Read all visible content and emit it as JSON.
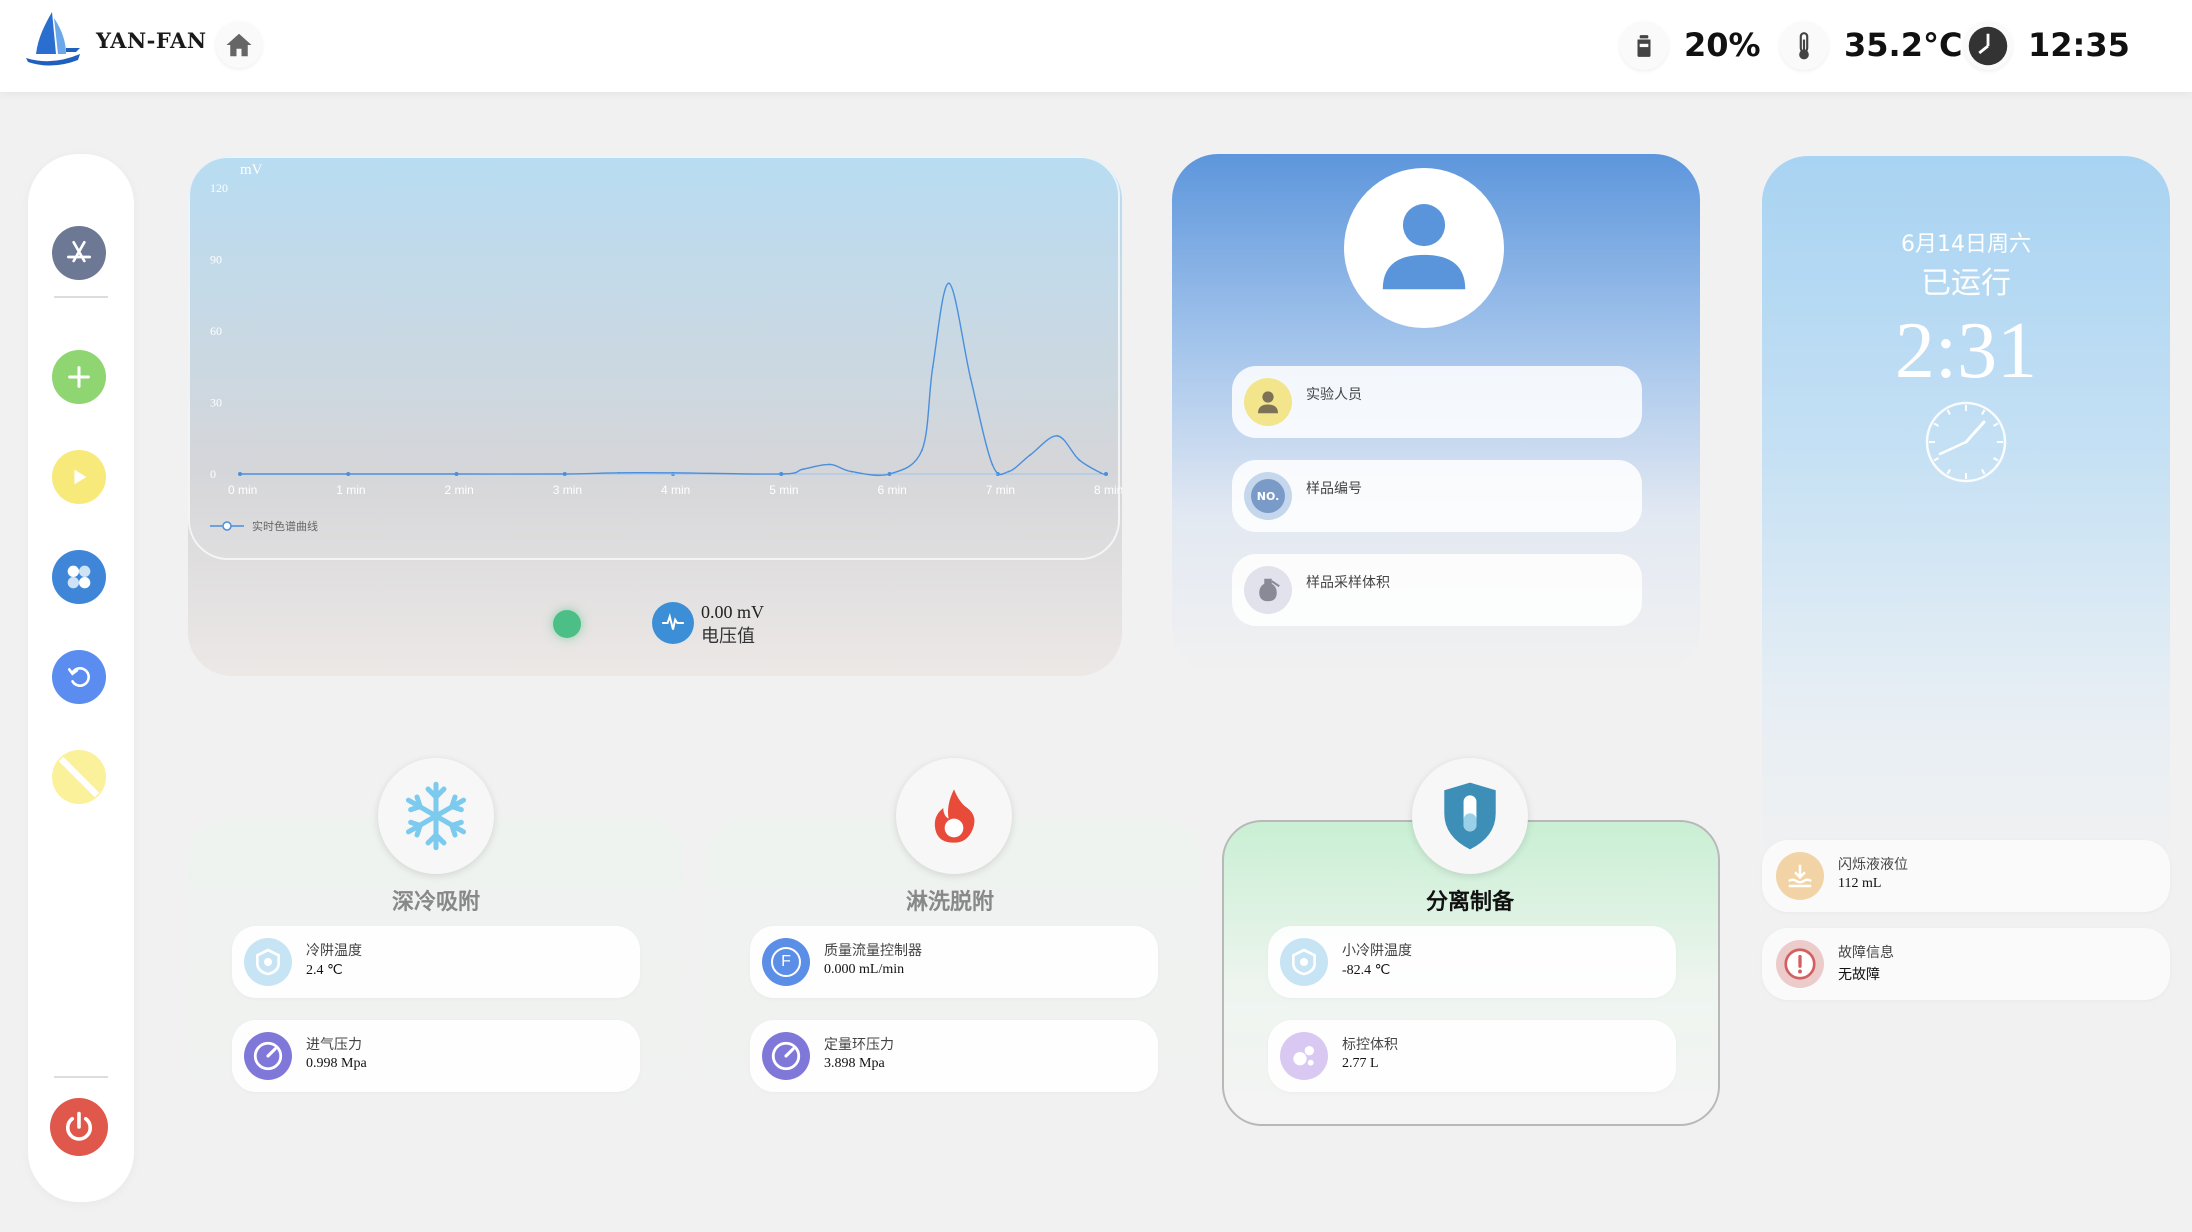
{
  "header": {
    "brand": "YAN-FAN",
    "level": "20%",
    "temperature": "35.2°C",
    "time": "12:35"
  },
  "chart_data": {
    "type": "line",
    "ylabel": "mV",
    "ylim": [
      0,
      120
    ],
    "y_ticks": [
      "120",
      "90",
      "60",
      "30",
      "0"
    ],
    "x_ticks": [
      "0 min",
      "1 min",
      "2 min",
      "3 min",
      "4 min",
      "5 min",
      "6 min",
      "7 min",
      "8 min"
    ],
    "xlim": [
      0,
      8
    ],
    "legend": "top-left-below",
    "series": [
      {
        "name": "实时色谱曲线",
        "x": [
          0,
          1,
          2,
          3,
          3.5,
          4,
          5,
          5.2,
          5.45,
          5.65,
          6.0,
          6.3,
          6.4,
          6.55,
          6.75,
          6.95,
          7.1,
          7.3,
          7.55,
          7.75,
          7.95,
          8.0
        ],
        "y": [
          0,
          0,
          0,
          0,
          0.5,
          0.5,
          0,
          2,
          4,
          1,
          0,
          10,
          45,
          80,
          40,
          4,
          1,
          8,
          16,
          6,
          0.5,
          0
        ]
      }
    ]
  },
  "chart_panel": {
    "voltage_value": "0.00 mV",
    "voltage_label": "电压值"
  },
  "profile": {
    "rows": [
      "实验人员",
      "样品编号",
      "样品采样体积"
    ],
    "no_badge": "NO."
  },
  "clock": {
    "date": "6月14日周六",
    "run_label": "已运行",
    "run_time": "2:31"
  },
  "status_rows": [
    {
      "title": "闪烁液液位",
      "value": "112 mL"
    },
    {
      "title": "故障信息",
      "value": "无故障"
    }
  ],
  "modules": [
    {
      "title": "深冷吸附",
      "params": [
        {
          "title": "冷阱温度",
          "value": "2.4 ℃"
        },
        {
          "title": "进气压力",
          "value": "0.998 Mpa"
        }
      ]
    },
    {
      "title": "淋洗脱附",
      "params": [
        {
          "title": "质量流量控制器",
          "value": "0.000 mL/min"
        },
        {
          "title": "定量环压力",
          "value": "3.898 Mpa"
        }
      ]
    },
    {
      "title": "分离制备",
      "params": [
        {
          "title": "小冷阱温度",
          "value": "-82.4 ℃"
        },
        {
          "title": "标控体积",
          "value": "2.77 L"
        }
      ]
    }
  ],
  "colors": {
    "accent_blue": "#3c8fd6",
    "status_green": "#4cbf86",
    "power_red": "#e0574b",
    "active_green": "#c9efd4"
  }
}
